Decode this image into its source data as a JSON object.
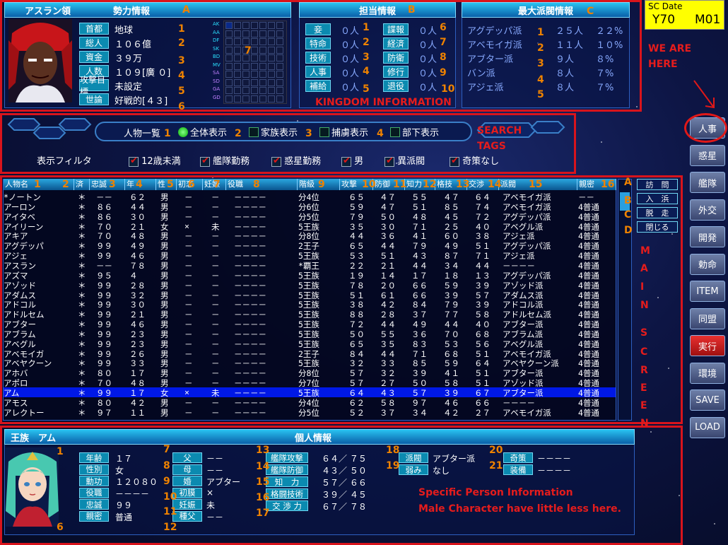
{
  "date": {
    "label": "SC Date",
    "year": "Y70",
    "month": "M01"
  },
  "faction": {
    "header": "アスラン領",
    "title": "勢力情報",
    "fields": [
      {
        "label": "首都",
        "value": "地球"
      },
      {
        "label": "総人",
        "value": "１０６億"
      },
      {
        "label": "資金",
        "value": "３９万"
      },
      {
        "label": "人数",
        "value": "１０９[廣 ０]"
      },
      {
        "label": "攻撃目標",
        "value": "未設定"
      },
      {
        "label": "世論",
        "value": "好戦的[４３]"
      }
    ],
    "grid_rows": [
      "AK",
      "AA",
      "DF",
      "SK",
      "BD",
      "MV",
      "SA",
      "SD",
      "GA",
      "GD"
    ]
  },
  "duty": {
    "title": "担当情報",
    "left": [
      {
        "label": "妾",
        "value": "０人"
      },
      {
        "label": "特命",
        "value": "０人"
      },
      {
        "label": "技術",
        "value": "０人"
      },
      {
        "label": "人事",
        "value": "０人"
      },
      {
        "label": "補給",
        "value": "０人"
      }
    ],
    "right": [
      {
        "label": "諜報",
        "value": "０人"
      },
      {
        "label": "経済",
        "value": "０人"
      },
      {
        "label": "防衛",
        "value": "０人"
      },
      {
        "label": "修行",
        "value": "０人"
      },
      {
        "label": "退役",
        "value": "０人"
      }
    ]
  },
  "factions": {
    "title": "最大派閥情報",
    "items": [
      {
        "name": "アグデッパ派",
        "count": "２５人",
        "pct": "２２%"
      },
      {
        "name": "アベモイガ派",
        "count": "１１人",
        "pct": "１０%"
      },
      {
        "name": "アブター派",
        "count": "９人",
        "pct": "８%"
      },
      {
        "name": "バン派",
        "count": "８人",
        "pct": "７%"
      },
      {
        "name": "アジェ派",
        "count": "８人",
        "pct": "７%"
      }
    ]
  },
  "annotations": {
    "A": "A",
    "B": "B",
    "C": "C",
    "D": "D",
    "kingdom": "KINGDOM INFORMATION",
    "search": "SEARCH",
    "tags": "TAGS",
    "here1": "WE ARE",
    "here2": "HERE",
    "main": [
      "M",
      "A",
      "I",
      "N",
      "S",
      "C",
      "R",
      "E",
      "E",
      "N"
    ],
    "person1": "Specific Person Information",
    "person2": "Male Character have little less here.",
    "n1": "1",
    "n2": "2",
    "n3": "3",
    "n4": "4",
    "n5": "5",
    "n6": "6",
    "n7": "7",
    "n8": "8",
    "n9": "9",
    "n10": "10",
    "n11": "11",
    "n12": "12",
    "n13": "13",
    "n14": "14",
    "n15": "15",
    "n16": "16",
    "n17": "17",
    "n18": "18",
    "n19": "19",
    "n20": "20",
    "n21": "21"
  },
  "tabs": {
    "list_label": "人物一覧",
    "options": [
      {
        "label": "全体表示",
        "on": true
      },
      {
        "label": "家族表示",
        "on": false
      },
      {
        "label": "捕虜表示",
        "on": false
      },
      {
        "label": "部下表示",
        "on": false
      }
    ]
  },
  "filter": {
    "label": "表示フィルタ",
    "items": [
      "12歳未満",
      "艦隊勤務",
      "惑星勤務",
      "男",
      "異派閥",
      "奇策なし"
    ]
  },
  "table": {
    "columns": [
      "人物名",
      "済",
      "忠誠",
      "年",
      "性",
      "初恋",
      "妊娠",
      "役職",
      "階級",
      "攻撃",
      "防御",
      "知力",
      "格技",
      "交渉",
      "派閥",
      "親密"
    ],
    "rows": [
      [
        "*ノートン",
        "＊",
        "－－",
        "６２",
        "男",
        "－",
        "－",
        "－－－－",
        "分4位",
        "６５",
        "４７",
        "５５",
        "４７",
        "６４",
        "アベモイガ派",
        "－－"
      ],
      [
        "アーロン",
        "＊",
        "８６",
        "４４",
        "男",
        "－",
        "－",
        "－－－－",
        "分6位",
        "５９",
        "４７",
        "５１",
        "８５",
        "７４",
        "アベモイガ派",
        "4普通"
      ],
      [
        "アイタベ",
        "＊",
        "８６",
        "３０",
        "男",
        "－",
        "－",
        "－－－－",
        "分5位",
        "７９",
        "５０",
        "４８",
        "４５",
        "７２",
        "アグデッパ派",
        "4普通"
      ],
      [
        "アイリーン",
        "＊",
        "７０",
        "２１",
        "女",
        "×",
        "未",
        "－－－－",
        "5王族",
        "３５",
        "３０",
        "７１",
        "２５",
        "４０",
        "アベグル派",
        "4普通"
      ],
      [
        "アキア",
        "＊",
        "７０",
        "４８",
        "男",
        "－",
        "－",
        "－－－－",
        "分8位",
        "４４",
        "３６",
        "４１",
        "６０",
        "３８",
        "アジェ派",
        "4普通"
      ],
      [
        "アグデッパ",
        "＊",
        "９９",
        "４９",
        "男",
        "－",
        "－",
        "－－－－",
        "2王子",
        "６５",
        "４４",
        "７９",
        "４９",
        "５１",
        "アグデッパ派",
        "4普通"
      ],
      [
        "アジェ",
        "＊",
        "９９",
        "４６",
        "男",
        "－",
        "－",
        "－－－－",
        "5王族",
        "５３",
        "５１",
        "４３",
        "８７",
        "７１",
        "アジェ派",
        "4普通"
      ],
      [
        "アスラン",
        "＊",
        "－－",
        "７８",
        "男",
        "－",
        "－",
        "－－－－",
        "*覇王",
        "２２",
        "２１",
        "４４",
        "３４",
        "４４",
        "－－－－",
        "4普通"
      ],
      [
        "アズマ",
        "＊",
        "９５",
        "４",
        "男",
        "－",
        "－",
        "－－－－",
        "5王族",
        "１９",
        "１４",
        "１７",
        "１８",
        "１３",
        "アグデッパ派",
        "4普通"
      ],
      [
        "アゾッド",
        "＊",
        "９９",
        "２８",
        "男",
        "－",
        "－",
        "－－－－",
        "5王族",
        "７８",
        "２０",
        "６６",
        "５９",
        "３９",
        "アゾッド派",
        "4普通"
      ],
      [
        "アダムス",
        "＊",
        "９９",
        "３２",
        "男",
        "－",
        "－",
        "－－－－",
        "5王族",
        "５１",
        "６１",
        "６６",
        "３９",
        "５７",
        "アダムス派",
        "4普通"
      ],
      [
        "アドコル",
        "＊",
        "９９",
        "３０",
        "男",
        "－",
        "－",
        "－－－－",
        "5王族",
        "３８",
        "４２",
        "８４",
        "７９",
        "３９",
        "アドコル派",
        "4普通"
      ],
      [
        "アドルセム",
        "＊",
        "９９",
        "２１",
        "男",
        "－",
        "－",
        "－－－－",
        "5王族",
        "８８",
        "２８",
        "３７",
        "７７",
        "５８",
        "アドルセム派",
        "4普通"
      ],
      [
        "アブター",
        "＊",
        "９９",
        "４６",
        "男",
        "－",
        "－",
        "－－－－",
        "5王族",
        "７２",
        "４４",
        "４９",
        "４４",
        "４０",
        "アブター派",
        "4普通"
      ],
      [
        "アブラム",
        "＊",
        "９９",
        "２３",
        "男",
        "－",
        "－",
        "－－－－",
        "5王族",
        "５０",
        "５５",
        "３６",
        "７０",
        "６８",
        "アブラム派",
        "4普通"
      ],
      [
        "アベグル",
        "＊",
        "９９",
        "２３",
        "男",
        "－",
        "－",
        "－－－－",
        "5王族",
        "６５",
        "３５",
        "８３",
        "５３",
        "５６",
        "アベグル派",
        "4普通"
      ],
      [
        "アベモイガ",
        "＊",
        "９９",
        "２６",
        "男",
        "－",
        "－",
        "－－－－",
        "2王子",
        "８４",
        "４４",
        "７１",
        "６８",
        "５１",
        "アベモイガ派",
        "4普通"
      ],
      [
        "アベヤクーン",
        "＊",
        "９９",
        "３３",
        "男",
        "－",
        "－",
        "－－－－",
        "5王族",
        "３２",
        "３３",
        "８５",
        "５９",
        "６４",
        "アベヤクーン派",
        "4普通"
      ],
      [
        "アホバ",
        "＊",
        "８０",
        "１７",
        "男",
        "－",
        "－",
        "－－－－",
        "分8位",
        "５７",
        "３２",
        "３９",
        "４１",
        "５１",
        "アブター派",
        "4普通"
      ],
      [
        "アポロ",
        "＊",
        "７０",
        "４８",
        "男",
        "－",
        "－",
        "－－－－",
        "分7位",
        "５７",
        "２７",
        "５０",
        "５８",
        "５１",
        "アゾッド派",
        "4普通"
      ],
      [
        "アム",
        "＊",
        "９９",
        "１７",
        "女",
        "×",
        "未",
        "－－－－",
        "5王族",
        "６４",
        "４３",
        "５７",
        "３９",
        "６７",
        "アブター派",
        "4普通"
      ],
      [
        "アモス",
        "＊",
        "８０",
        "４２",
        "男",
        "－",
        "－",
        "－－－－",
        "分4位",
        "６２",
        "５８",
        "９７",
        "４６",
        "６６",
        "－－－－",
        "4普通"
      ],
      [
        "アレクトー",
        "＊",
        "９７",
        "１１",
        "男",
        "－",
        "－",
        "－－－－",
        "分5位",
        "５２",
        "３７",
        "３４",
        "４２",
        "２７",
        "アベモイガ派",
        "4普通"
      ]
    ],
    "selected": 20
  },
  "actions": [
    "訪　問",
    "入　浜",
    "脱　走",
    "閉じる"
  ],
  "sidebar": [
    "人事",
    "惑星",
    "艦隊",
    "外交",
    "開発",
    "勅命",
    "ITEM",
    "同盟",
    "実行",
    "環境",
    "SAVE",
    "LOAD"
  ],
  "person": {
    "name": "王族　アム",
    "title": "個人情報",
    "c1": [
      {
        "label": "年齢",
        "value": "１７"
      },
      {
        "label": "性別",
        "value": "女"
      },
      {
        "label": "勳功",
        "value": "１２０８０"
      },
      {
        "label": "役職",
        "value": "－－－－"
      },
      {
        "label": "忠誠",
        "value": "９９"
      },
      {
        "label": "親密",
        "value": "普通"
      }
    ],
    "c2": [
      {
        "label": "父",
        "value": "－－"
      },
      {
        "label": "母",
        "value": "－－"
      },
      {
        "label": "婚",
        "value": "アブター"
      },
      {
        "label": "初膜",
        "value": "×"
      },
      {
        "label": "妊娠",
        "value": "未"
      },
      {
        "label": "種父",
        "value": "－－"
      }
    ],
    "c3": [
      {
        "label": "艦隊攻撃",
        "value": "６４／ ７５"
      },
      {
        "label": "艦隊防御",
        "value": "４３／ ５０"
      },
      {
        "label": "知　力",
        "value": "５７／ ６６"
      },
      {
        "label": "格闘技術",
        "value": "３９／ ４５"
      },
      {
        "label": "交 渉 力",
        "value": "６７／ ７８"
      }
    ],
    "c4": [
      {
        "label": "派閥",
        "value": "アブター派"
      },
      {
        "label": "弱み",
        "value": "なし"
      }
    ],
    "c5": [
      {
        "label": "奇策",
        "value": "－－－－"
      },
      {
        "label": "装備",
        "value": "－－－－"
      }
    ]
  }
}
